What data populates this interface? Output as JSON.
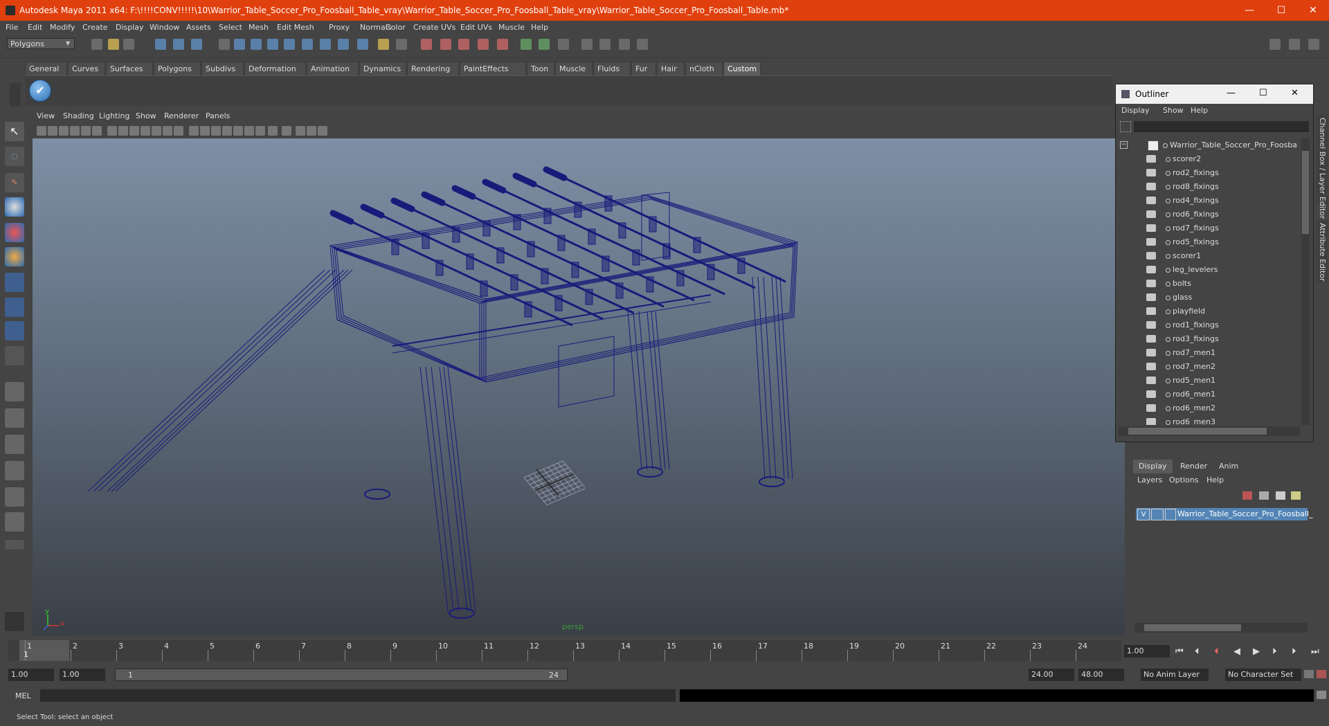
{
  "window": {
    "title": "Autodesk Maya 2011 x64: F:\\!!!!CONV!!!!!\\10\\Warrior_Table_Soccer_Pro_Foosball_Table_vray\\Warrior_Table_Soccer_Pro_Foosball_Table_vray\\Warrior_Table_Soccer_Pro_Foosball_Table.mb*",
    "minimize": "—",
    "maximize": "☐",
    "close": "✕"
  },
  "menubar": [
    "File",
    "Edit",
    "Modify",
    "Create",
    "Display",
    "Window",
    "Assets",
    "Select",
    "Mesh",
    "Edit Mesh",
    "Proxy",
    "Normals",
    "Color",
    "Create UVs",
    "Edit UVs",
    "Muscle",
    "Help"
  ],
  "mode_select": "Polygons",
  "shelf_tabs": [
    "General",
    "Curves",
    "Surfaces",
    "Polygons",
    "Subdivs",
    "Deformation",
    "Animation",
    "Dynamics",
    "Rendering",
    "PaintEffects",
    "Toon",
    "Muscle",
    "Fluids",
    "Fur",
    "Hair",
    "nCloth",
    "Custom"
  ],
  "active_shelf_tab": "Custom",
  "viewport": {
    "menu": [
      "View",
      "Shading",
      "Lighting",
      "Show",
      "Renderer",
      "Panels"
    ],
    "camera_label": "persp",
    "axis_x": "x",
    "axis_y": "y",
    "wire_color": "#1a1a7a"
  },
  "outliner": {
    "title": "Outliner",
    "menu": [
      "Display",
      "Show",
      "Help"
    ],
    "root": "Warrior_Table_Soccer_Pro_Foosball_Tal",
    "items": [
      "scorer2",
      "rod2_fixings",
      "rod8_fixings",
      "rod4_fixings",
      "rod6_fixings",
      "rod7_fixings",
      "rod5_fixings",
      "scorer1",
      "leg_levelers",
      "bolts",
      "glass",
      "playfield",
      "rod1_fixings",
      "rod3_fixings",
      "rod7_men1",
      "rod7_men2",
      "rod5_men1",
      "rod6_men1",
      "rod6_men2",
      "rod6_men3"
    ]
  },
  "side_tabs": [
    "Channel Box / Layer Editor",
    "Attribute Editor"
  ],
  "layer_editor": {
    "tabs": [
      "Display",
      "Render",
      "Anim"
    ],
    "active_tab": "Display",
    "menu": [
      "Layers",
      "Options",
      "Help"
    ],
    "layer_visible": "V",
    "layer_name": "Warrior_Table_Soccer_Pro_Foosball_"
  },
  "timeline": {
    "ticks": [
      "1",
      "2",
      "3",
      "4",
      "5",
      "6",
      "7",
      "8",
      "9",
      "10",
      "11",
      "12",
      "13",
      "14",
      "15",
      "16",
      "17",
      "18",
      "19",
      "20",
      "21",
      "22",
      "23",
      "24"
    ],
    "current_frame_marker": "1",
    "current_time": "1.00"
  },
  "range": {
    "start_time": "1.00",
    "playback_start": "1.00",
    "slider_start": "1",
    "slider_end": "24",
    "playback_end": "24.00",
    "end_time": "48.00",
    "anim_layer": "No Anim Layer",
    "char_set": "No Character Set"
  },
  "mel_label": "MEL",
  "help_line": "Select Tool: select an object"
}
